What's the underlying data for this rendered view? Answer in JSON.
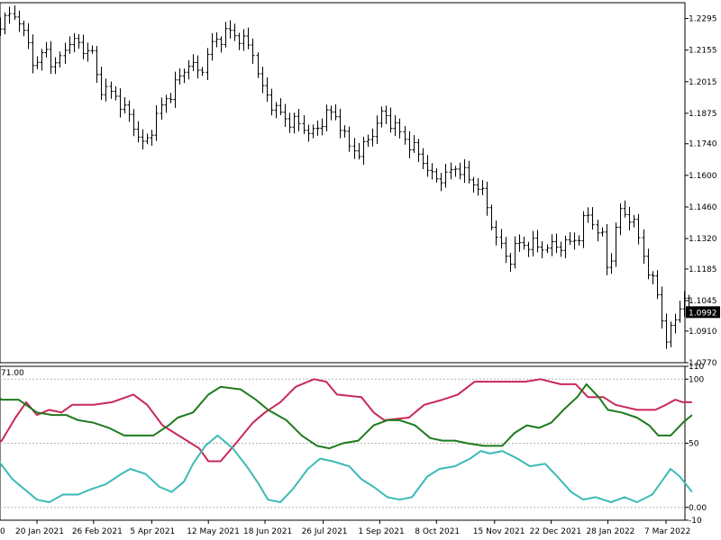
{
  "chart_data": [
    {
      "type": "ohlc",
      "title": "",
      "ylim": [
        1.077,
        1.2365
      ],
      "y_ticks": [
        "1.2295",
        "1.2155",
        "1.2015",
        "1.1875",
        "1.1740",
        "1.1600",
        "1.1460",
        "1.1320",
        "1.1185",
        "1.1045",
        "1.0910",
        "1.0770"
      ],
      "current_price": "1.0992",
      "colors": {
        "bars": "#000000",
        "price_tag_bg": "#000000",
        "price_tag_text": "#ffffff"
      },
      "close_path": [
        [
          "2020-12-18",
          1.224
        ],
        [
          "2021-01-06",
          1.232
        ],
        [
          "2021-01-19",
          1.208
        ],
        [
          "2021-01-25",
          1.216
        ],
        [
          "2021-02-01",
          1.208
        ],
        [
          "2021-02-10",
          1.22
        ],
        [
          "2021-02-25",
          1.214
        ],
        [
          "2021-03-01",
          1.2
        ],
        [
          "2021-03-12",
          1.195
        ],
        [
          "2021-03-22",
          1.185
        ],
        [
          "2021-03-31",
          1.172
        ],
        [
          "2021-04-09",
          1.188
        ],
        [
          "2021-04-20",
          1.2
        ],
        [
          "2021-04-29",
          1.21
        ],
        [
          "2021-05-06",
          1.205
        ],
        [
          "2021-05-14",
          1.218
        ],
        [
          "2021-05-25",
          1.224
        ],
        [
          "2021-06-03",
          1.22
        ],
        [
          "2021-06-10",
          1.215
        ],
        [
          "2021-06-15",
          1.199
        ],
        [
          "2021-06-24",
          1.19
        ],
        [
          "2021-07-01",
          1.185
        ],
        [
          "2021-07-09",
          1.183
        ],
        [
          "2021-07-20",
          1.178
        ],
        [
          "2021-07-28",
          1.188
        ],
        [
          "2021-08-05",
          1.185
        ],
        [
          "2021-08-11",
          1.173
        ],
        [
          "2021-08-19",
          1.17
        ],
        [
          "2021-08-26",
          1.178
        ],
        [
          "2021-09-03",
          1.188
        ],
        [
          "2021-09-10",
          1.182
        ],
        [
          "2021-09-21",
          1.173
        ],
        [
          "2021-09-28",
          1.168
        ],
        [
          "2021-10-06",
          1.158
        ],
        [
          "2021-10-14",
          1.16
        ],
        [
          "2021-10-22",
          1.164
        ],
        [
          "2021-10-29",
          1.158
        ],
        [
          "2021-11-05",
          1.155
        ],
        [
          "2021-11-10",
          1.146
        ],
        [
          "2021-11-16",
          1.132
        ],
        [
          "2021-11-24",
          1.122
        ],
        [
          "2021-11-30",
          1.13
        ],
        [
          "2021-12-10",
          1.129
        ],
        [
          "2021-12-20",
          1.128
        ],
        [
          "2022-01-03",
          1.13
        ],
        [
          "2022-01-10",
          1.134
        ],
        [
          "2022-01-14",
          1.144
        ],
        [
          "2022-01-24",
          1.132
        ],
        [
          "2022-01-28",
          1.116
        ],
        [
          "2022-02-04",
          1.144
        ],
        [
          "2022-02-10",
          1.143
        ],
        [
          "2022-02-16",
          1.135
        ],
        [
          "2022-02-24",
          1.115
        ],
        [
          "2022-03-01",
          1.108
        ],
        [
          "2022-03-07",
          1.086
        ],
        [
          "2022-03-12",
          1.095
        ],
        [
          "2022-03-17",
          1.105
        ],
        [
          "2022-03-24",
          1.0992
        ]
      ]
    },
    {
      "type": "line",
      "title": "",
      "header_label": "71.00",
      "ylim": [
        -10,
        110
      ],
      "y_ticks": [
        "110",
        "100",
        "50",
        "0.00",
        "-10"
      ],
      "levels": [
        100,
        50,
        0
      ],
      "x_tick_labels": [
        "20 Jan 2021",
        "26 Feb 2021",
        "5 Apr 2021",
        "12 May 2021",
        "18 Jun 2021",
        "26 Jul 2021",
        "1 Sep 2021",
        "8 Oct 2021",
        "15 Nov 2021",
        "22 Dec 2021",
        "28 Jan 2022",
        "7 Mar 2022"
      ],
      "x_tick_dates": [
        "2021-01-20",
        "2021-02-26",
        "2021-04-05",
        "2021-05-12",
        "2021-06-18",
        "2021-07-26",
        "2021-09-01",
        "2021-10-08",
        "2021-11-15",
        "2021-12-22",
        "2022-01-28",
        "2022-03-07"
      ],
      "x_first_label": "0",
      "series": [
        {
          "color": "#c8285a",
          "points": [
            [
              "2020-12-18",
              42
            ],
            [
              "2020-12-28",
              52
            ],
            [
              "2021-01-06",
              70
            ],
            [
              "2021-01-13",
              82
            ],
            [
              "2021-01-20",
              72
            ],
            [
              "2021-01-28",
              76
            ],
            [
              "2021-02-05",
              74
            ],
            [
              "2021-02-12",
              80
            ],
            [
              "2021-02-26",
              80
            ],
            [
              "2021-03-10",
              82
            ],
            [
              "2021-03-24",
              88
            ],
            [
              "2021-04-02",
              80
            ],
            [
              "2021-04-12",
              64
            ],
            [
              "2021-04-20",
              58
            ],
            [
              "2021-04-28",
              52
            ],
            [
              "2021-05-06",
              46
            ],
            [
              "2021-05-12",
              36
            ],
            [
              "2021-05-20",
              36
            ],
            [
              "2021-05-30",
              50
            ],
            [
              "2021-06-10",
              66
            ],
            [
              "2021-06-18",
              74
            ],
            [
              "2021-06-28",
              82
            ],
            [
              "2021-07-08",
              94
            ],
            [
              "2021-07-20",
              100
            ],
            [
              "2021-07-28",
              98
            ],
            [
              "2021-08-04",
              88
            ],
            [
              "2021-08-20",
              86
            ],
            [
              "2021-08-28",
              74
            ],
            [
              "2021-09-04",
              68
            ],
            [
              "2021-09-20",
              70
            ],
            [
              "2021-09-30",
              80
            ],
            [
              "2021-10-12",
              84
            ],
            [
              "2021-10-22",
              88
            ],
            [
              "2021-11-02",
              98
            ],
            [
              "2021-11-20",
              98
            ],
            [
              "2021-12-05",
              98
            ],
            [
              "2021-12-15",
              100
            ],
            [
              "2021-12-28",
              96
            ],
            [
              "2022-01-07",
              96
            ],
            [
              "2022-01-15",
              86
            ],
            [
              "2022-01-25",
              86
            ],
            [
              "2022-02-02",
              80
            ],
            [
              "2022-02-16",
              76
            ],
            [
              "2022-02-28",
              76
            ],
            [
              "2022-03-07",
              80
            ],
            [
              "2022-03-13",
              84
            ],
            [
              "2022-03-18",
              82
            ],
            [
              "2022-03-24",
              82
            ]
          ]
        },
        {
          "color": "#1e7a1e",
          "points": [
            [
              "2020-12-18",
              94
            ],
            [
              "2020-12-28",
              84
            ],
            [
              "2021-01-08",
              84
            ],
            [
              "2021-01-20",
              74
            ],
            [
              "2021-01-30",
              72
            ],
            [
              "2021-02-08",
              72
            ],
            [
              "2021-02-16",
              68
            ],
            [
              "2021-02-26",
              66
            ],
            [
              "2021-03-08",
              62
            ],
            [
              "2021-03-18",
              56
            ],
            [
              "2021-03-28",
              56
            ],
            [
              "2021-04-06",
              56
            ],
            [
              "2021-04-16",
              64
            ],
            [
              "2021-04-22",
              70
            ],
            [
              "2021-05-02",
              74
            ],
            [
              "2021-05-12",
              88
            ],
            [
              "2021-05-20",
              94
            ],
            [
              "2021-06-02",
              92
            ],
            [
              "2021-06-12",
              84
            ],
            [
              "2021-06-20",
              76
            ],
            [
              "2021-07-02",
              68
            ],
            [
              "2021-07-12",
              56
            ],
            [
              "2021-07-22",
              48
            ],
            [
              "2021-07-30",
              46
            ],
            [
              "2021-08-08",
              50
            ],
            [
              "2021-08-18",
              52
            ],
            [
              "2021-08-28",
              64
            ],
            [
              "2021-09-06",
              68
            ],
            [
              "2021-09-14",
              68
            ],
            [
              "2021-09-24",
              64
            ],
            [
              "2021-10-04",
              54
            ],
            [
              "2021-10-12",
              52
            ],
            [
              "2021-10-20",
              52
            ],
            [
              "2021-10-28",
              50
            ],
            [
              "2021-11-08",
              48
            ],
            [
              "2021-11-20",
              48
            ],
            [
              "2021-11-28",
              58
            ],
            [
              "2021-12-06",
              64
            ],
            [
              "2021-12-14",
              62
            ],
            [
              "2021-12-22",
              66
            ],
            [
              "2021-12-30",
              76
            ],
            [
              "2022-01-08",
              86
            ],
            [
              "2022-01-14",
              96
            ],
            [
              "2022-01-22",
              86
            ],
            [
              "2022-01-28",
              76
            ],
            [
              "2022-02-06",
              74
            ],
            [
              "2022-02-16",
              70
            ],
            [
              "2022-02-24",
              64
            ],
            [
              "2022-03-02",
              56
            ],
            [
              "2022-03-10",
              56
            ],
            [
              "2022-03-18",
              66
            ],
            [
              "2022-03-24",
              72
            ]
          ]
        },
        {
          "color": "#3cbab8",
          "points": [
            [
              "2020-12-18",
              44
            ],
            [
              "2020-12-26",
              36
            ],
            [
              "2021-01-04",
              22
            ],
            [
              "2021-01-12",
              14
            ],
            [
              "2021-01-20",
              6
            ],
            [
              "2021-01-28",
              4
            ],
            [
              "2021-02-06",
              10
            ],
            [
              "2021-02-16",
              10
            ],
            [
              "2021-02-24",
              14
            ],
            [
              "2021-03-06",
              18
            ],
            [
              "2021-03-16",
              26
            ],
            [
              "2021-03-22",
              30
            ],
            [
              "2021-04-01",
              26
            ],
            [
              "2021-04-10",
              16
            ],
            [
              "2021-04-18",
              12
            ],
            [
              "2021-04-26",
              20
            ],
            [
              "2021-05-02",
              34
            ],
            [
              "2021-05-10",
              48
            ],
            [
              "2021-05-18",
              56
            ],
            [
              "2021-05-28",
              46
            ],
            [
              "2021-06-06",
              32
            ],
            [
              "2021-06-14",
              18
            ],
            [
              "2021-06-20",
              6
            ],
            [
              "2021-06-28",
              4
            ],
            [
              "2021-07-06",
              14
            ],
            [
              "2021-07-16",
              30
            ],
            [
              "2021-07-24",
              38
            ],
            [
              "2021-08-01",
              36
            ],
            [
              "2021-08-12",
              32
            ],
            [
              "2021-08-20",
              22
            ],
            [
              "2021-08-28",
              16
            ],
            [
              "2021-09-06",
              8
            ],
            [
              "2021-09-14",
              6
            ],
            [
              "2021-09-22",
              8
            ],
            [
              "2021-10-02",
              24
            ],
            [
              "2021-10-10",
              30
            ],
            [
              "2021-10-20",
              32
            ],
            [
              "2021-10-30",
              38
            ],
            [
              "2021-11-06",
              44
            ],
            [
              "2021-11-12",
              42
            ],
            [
              "2021-11-20",
              44
            ],
            [
              "2021-11-30",
              38
            ],
            [
              "2021-12-08",
              32
            ],
            [
              "2021-12-18",
              34
            ],
            [
              "2021-12-26",
              24
            ],
            [
              "2022-01-04",
              12
            ],
            [
              "2022-01-12",
              6
            ],
            [
              "2022-01-20",
              8
            ],
            [
              "2022-01-30",
              4
            ],
            [
              "2022-02-08",
              8
            ],
            [
              "2022-02-16",
              4
            ],
            [
              "2022-02-26",
              10
            ],
            [
              "2022-03-04",
              20
            ],
            [
              "2022-03-10",
              30
            ],
            [
              "2022-03-16",
              24
            ],
            [
              "2022-03-24",
              12
            ]
          ]
        }
      ]
    }
  ]
}
